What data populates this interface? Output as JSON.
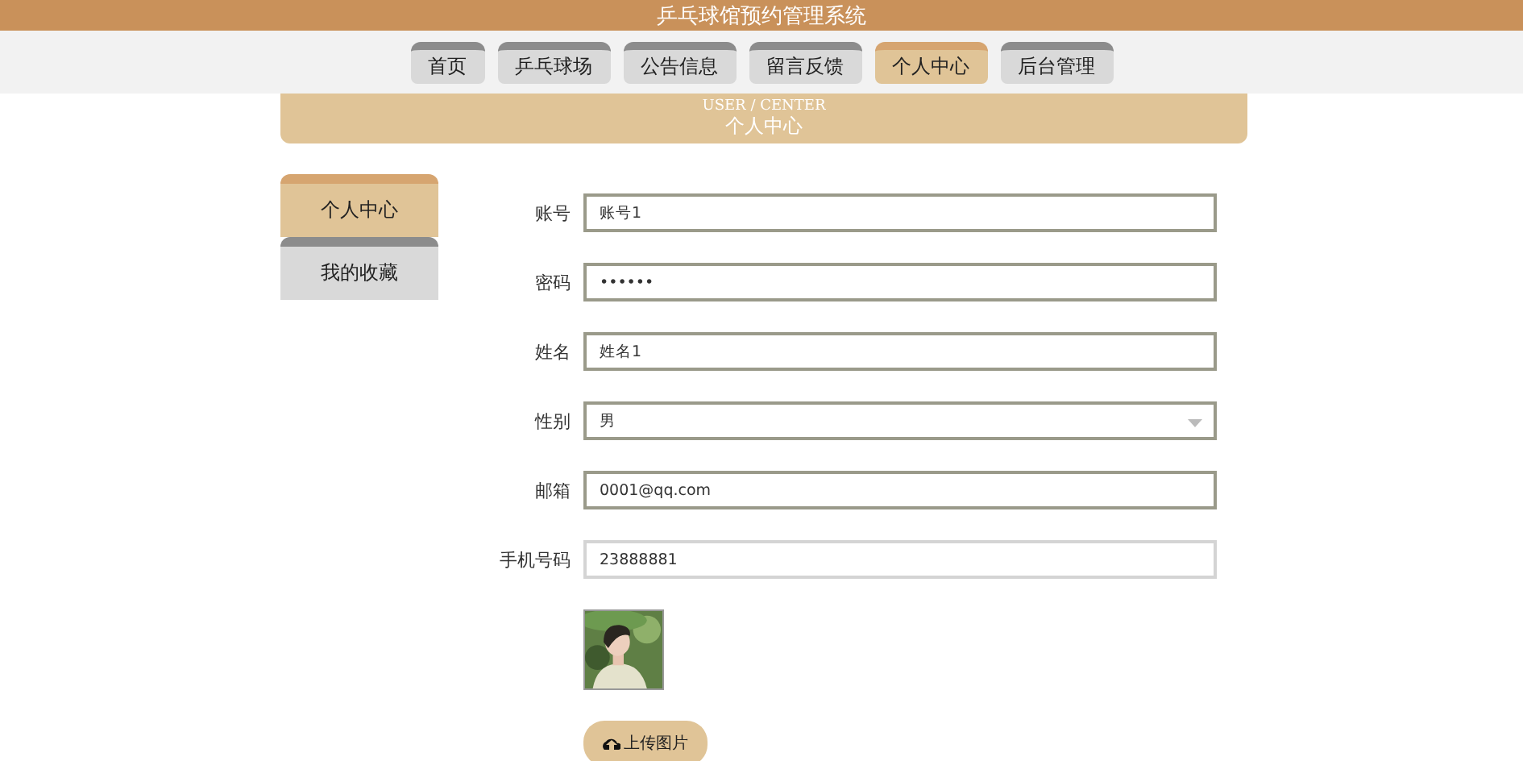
{
  "header": {
    "title": "乒乓球馆预约管理系统"
  },
  "nav": [
    {
      "label": "首页",
      "selected": false
    },
    {
      "label": "乒乓球场",
      "selected": false
    },
    {
      "label": "公告信息",
      "selected": false
    },
    {
      "label": "留言反馈",
      "selected": false
    },
    {
      "label": "个人中心",
      "selected": true
    },
    {
      "label": "后台管理",
      "selected": false
    }
  ],
  "banner": {
    "subtitle": "USER / CENTER",
    "title": "个人中心"
  },
  "sidebar": {
    "items": [
      {
        "label": "个人中心",
        "selected": true
      },
      {
        "label": "我的收藏",
        "selected": false
      }
    ]
  },
  "form": {
    "fields": [
      {
        "label": "账号",
        "kind": "text",
        "value": "账号1",
        "focused": false
      },
      {
        "label": "密码",
        "kind": "password",
        "value": "••••••",
        "focused": false
      },
      {
        "label": "姓名",
        "kind": "text",
        "value": "姓名1",
        "focused": false
      },
      {
        "label": "性别",
        "kind": "select",
        "value": "男",
        "focused": false
      },
      {
        "label": "邮箱",
        "kind": "text",
        "value": "0001@qq.com",
        "focused": false
      },
      {
        "label": "手机号码",
        "kind": "text",
        "value": "23888881",
        "focused": true
      }
    ],
    "upload_button": "上传图片"
  }
}
